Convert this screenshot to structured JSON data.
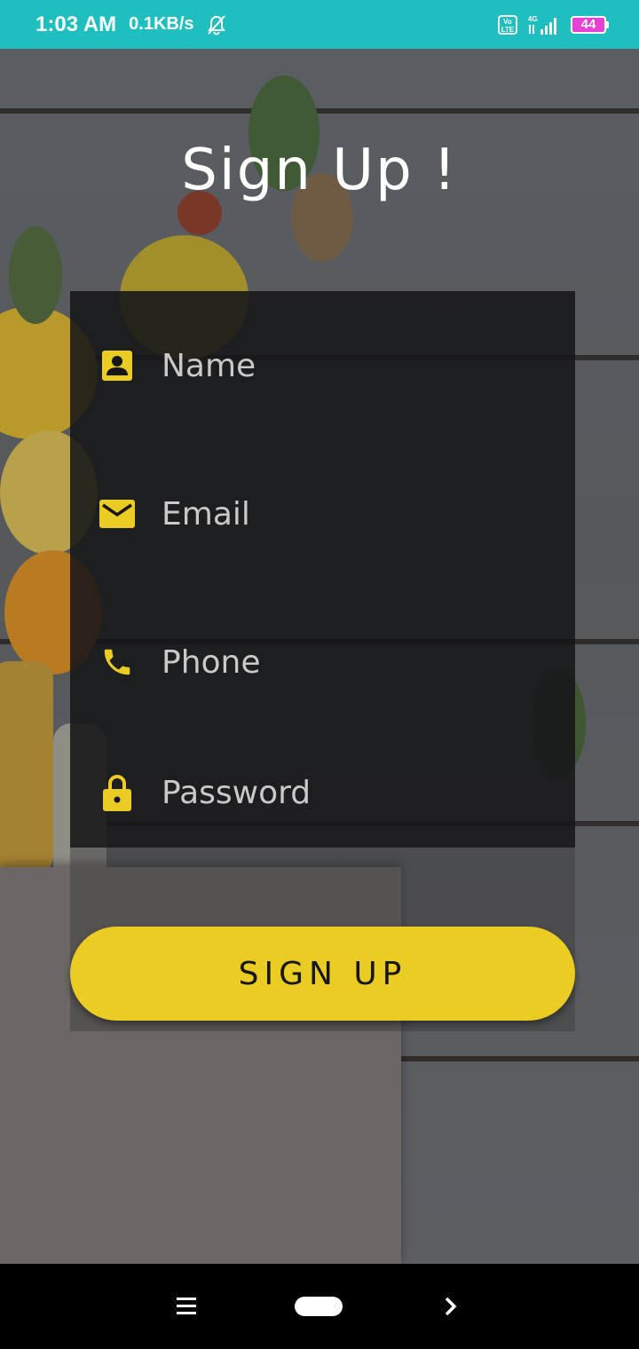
{
  "status_bar": {
    "time": "1:03 AM",
    "speed": "0.1KB/s",
    "volte": "Vo LTE",
    "network": "4G",
    "battery": "44"
  },
  "title": "Sign Up !",
  "form": {
    "name_placeholder": "Name",
    "email_placeholder": "Email",
    "phone_placeholder": "Phone",
    "password_placeholder": "Password",
    "icons": {
      "name": "person-icon",
      "email": "mail-icon",
      "phone": "phone-icon",
      "password": "lock-icon"
    },
    "icon_color": "#EBCC22"
  },
  "signup_button": "SIGN UP",
  "colors": {
    "status_bar": "#20BFBF",
    "accent": "#EBCC22",
    "panel": "#161618"
  }
}
